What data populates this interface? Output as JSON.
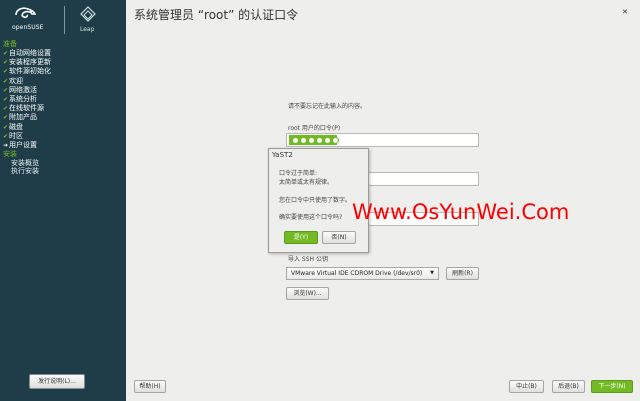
{
  "brand": {
    "name": "openSUSE",
    "edition": "Leap"
  },
  "sidebar": {
    "sections": [
      {
        "label": "准备",
        "items": [
          {
            "label": "自动网络设置",
            "mark": "✔"
          },
          {
            "label": "安装程序更新",
            "mark": "✔"
          },
          {
            "label": "软件源初始化",
            "mark": "✔"
          },
          {
            "label": "欢迎",
            "mark": "✔"
          },
          {
            "label": "网络激活",
            "mark": "✔"
          },
          {
            "label": "系统分析",
            "mark": "✔"
          },
          {
            "label": "在线软件源",
            "mark": "✔"
          },
          {
            "label": "附加产品",
            "mark": "✔"
          },
          {
            "label": "磁盘",
            "mark": "✔"
          },
          {
            "label": "时区",
            "mark": "✔"
          },
          {
            "label": "用户设置",
            "mark": "➜"
          }
        ]
      },
      {
        "label": "安装",
        "items": [
          {
            "label": "安装概览"
          },
          {
            "label": "执行安装"
          }
        ]
      }
    ],
    "release_notes_button": "发行说明(L)..."
  },
  "page": {
    "title": "系统管理员 “root” 的认证口令",
    "hint": "请不要忘记在此输入的内容。",
    "password_label": "root 用户的口令(P)",
    "import_label": "导入 SSH 公钥",
    "ssh_device": "VMware Virtual IDE CDROM Drive (/dev/sr0)",
    "refresh_button": "刷新(R)",
    "browse_button": "浏览(W)..."
  },
  "dialog": {
    "title": "YaST2",
    "line1": "口令过于简单:",
    "line2": "太简单或太有规律。",
    "line3": "您在口令中只使用了数字。",
    "line4": "确实要使用这个口令吗?",
    "yes_button": "是(Y)",
    "no_button": "否(N)"
  },
  "footer": {
    "help_button": "帮助(H)",
    "abort_button": "中止(B)",
    "back_button": "后退(B)",
    "next_button": "下一步(N)"
  },
  "watermark": "Www.OsYunWei.Com",
  "colors": {
    "accent": "#73ba25",
    "sidebar": "#1e3d48",
    "watermark": "#ff0000"
  }
}
